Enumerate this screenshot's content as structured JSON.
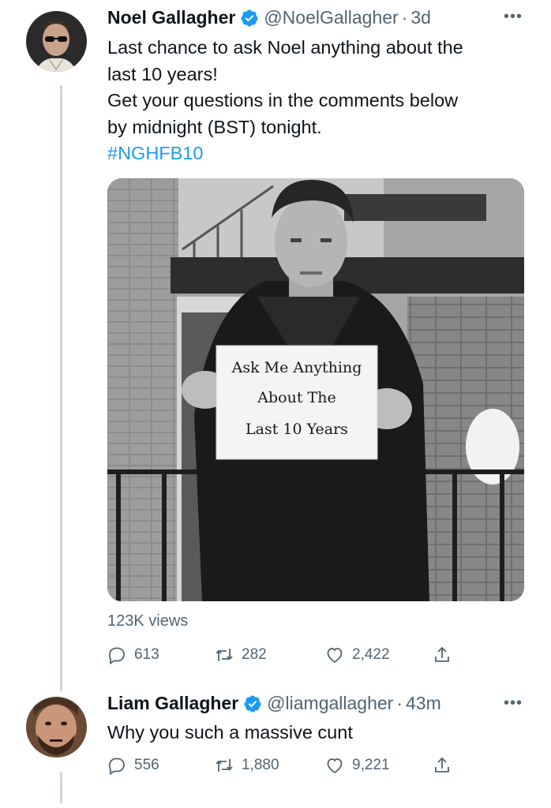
{
  "tweet1": {
    "name": "Noel Gallagher",
    "handle": "@NoelGallagher",
    "time": "3d",
    "text_lines": [
      "Last chance to ask Noel anything about the",
      "last 10 years!",
      "Get your questions in the comments below",
      "by midnight (BST) tonight."
    ],
    "hashtag": "#NGHFB10",
    "sign_lines": [
      "Ask Me Anything",
      "About The",
      "Last 10 Years"
    ],
    "views": "123K views",
    "replies": "613",
    "retweets": "282",
    "likes": "2,422"
  },
  "tweet2": {
    "name": "Liam Gallagher",
    "handle": "@liamgallagher",
    "time": "43m",
    "text": "Why you such a massive cunt",
    "replies": "556",
    "retweets": "1,880",
    "likes": "9,221"
  },
  "icons": {
    "verified": "verified-badge-icon",
    "more": "more-options-icon",
    "reply": "reply-icon",
    "retweet": "retweet-icon",
    "like": "like-icon",
    "share": "share-icon"
  },
  "colors": {
    "accent": "#1d9bf0",
    "muted": "#536471",
    "text": "#0f1419",
    "thread_line": "#cfd9de"
  }
}
